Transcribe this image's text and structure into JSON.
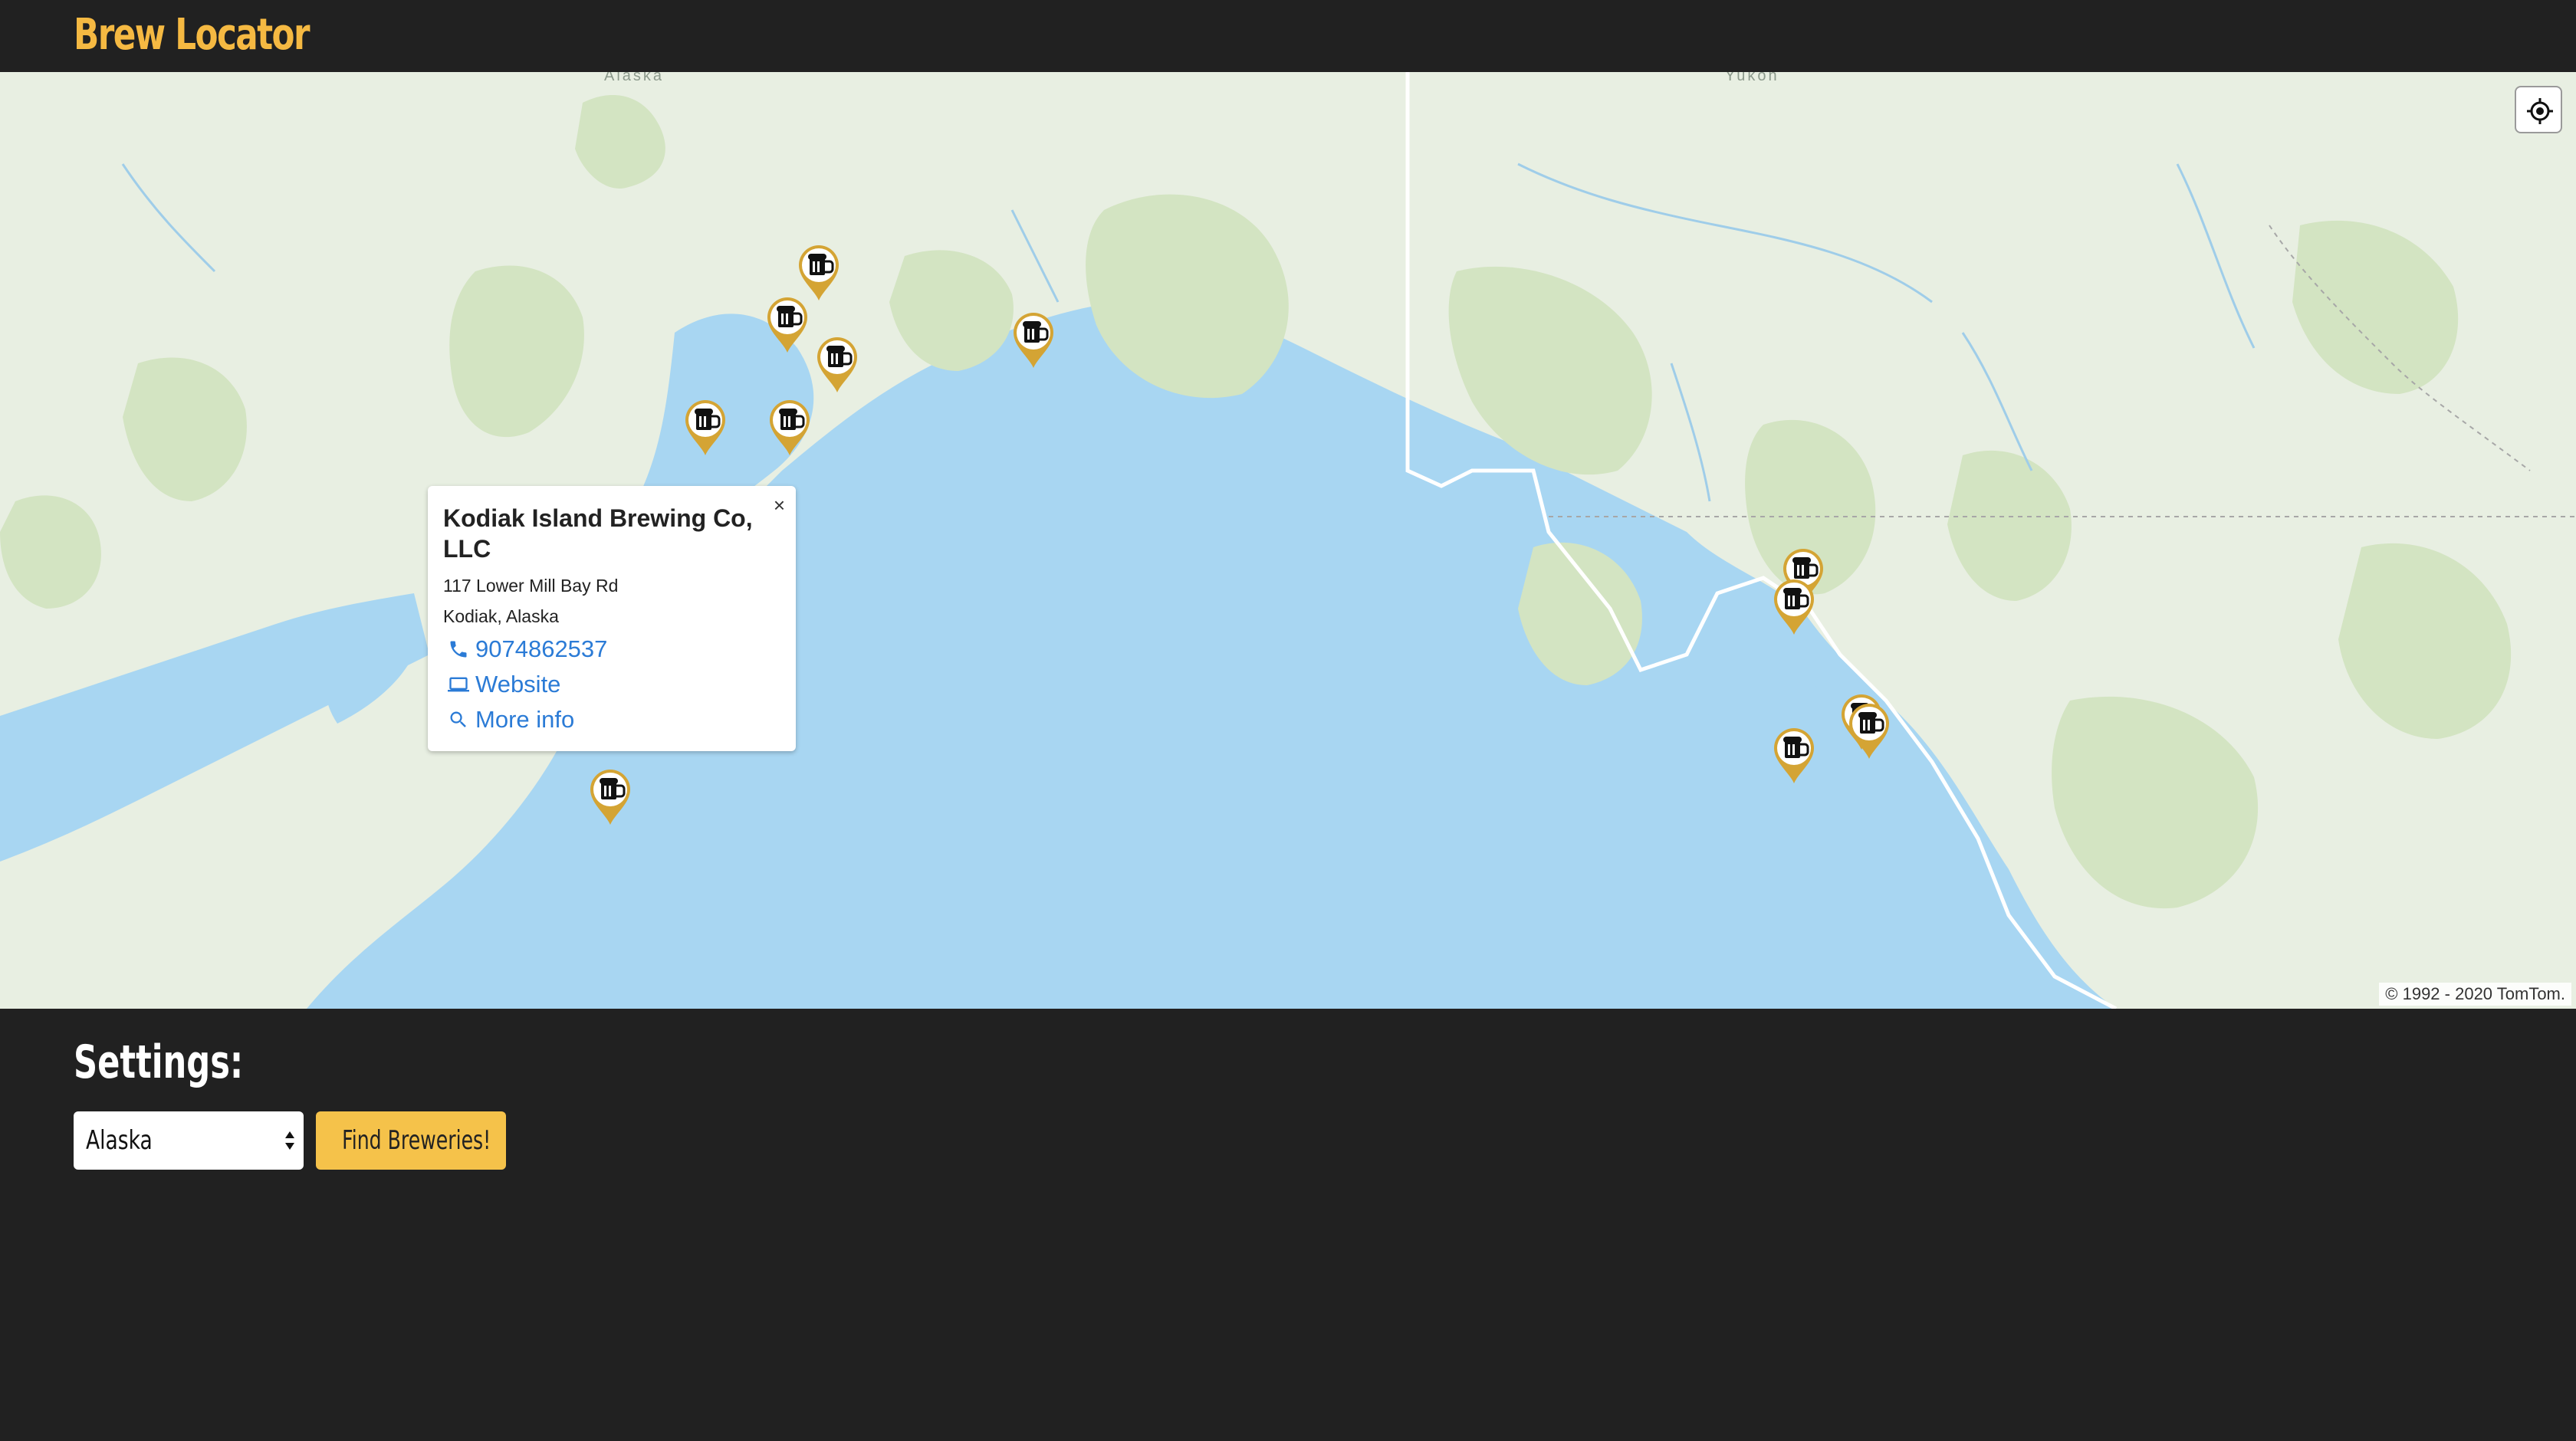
{
  "header": {
    "title": "Brew Locator"
  },
  "map": {
    "region_labels": [
      "Alaska",
      "Yukon"
    ],
    "attribution": "© 1992 - 2020 TomTom.",
    "locate_icon": "crosshair-icon",
    "marker_icon": "beer-mug-icon",
    "marker_color": "#d4a434",
    "water_color": "#a8d6f2",
    "land_color": "#e7efe1",
    "forest_color": "#d3e4c2"
  },
  "popup": {
    "name": "Kodiak Island Brewing Co, LLC",
    "street": "117 Lower Mill Bay Rd",
    "city_state": "Kodiak, Alaska",
    "phone": "9074862537",
    "website_label": "Website",
    "more_info_label": "More info",
    "close_label": "×"
  },
  "settings": {
    "title": "Settings:",
    "selected_state": "Alaska",
    "find_button_label": "Find Breweries!",
    "accent_color": "#f5c24a"
  }
}
